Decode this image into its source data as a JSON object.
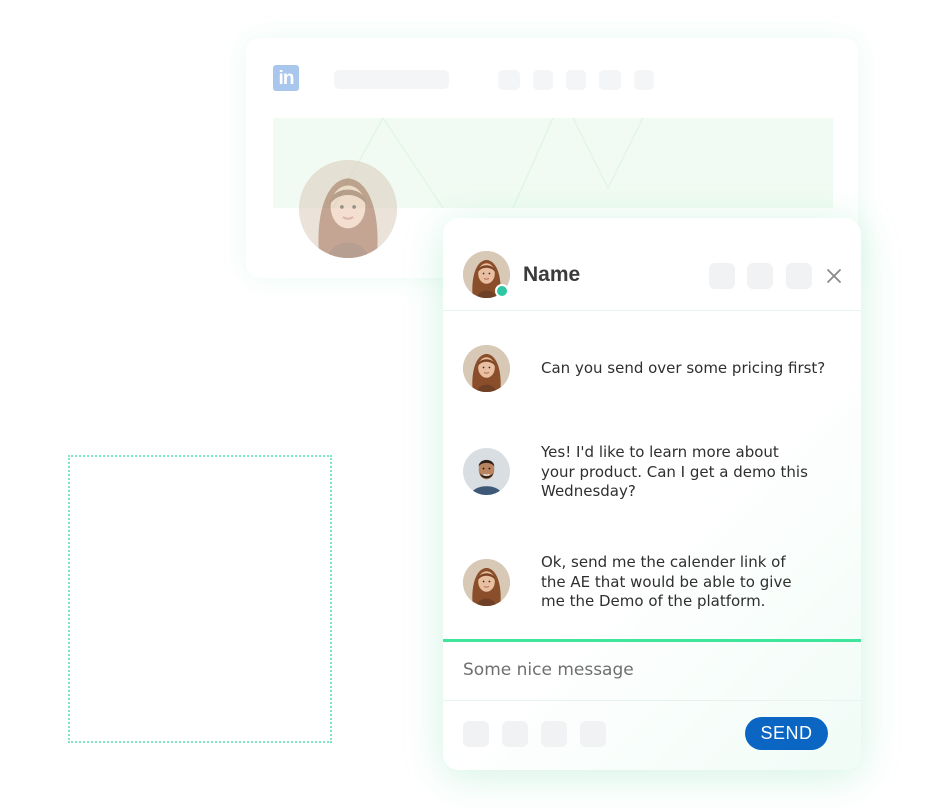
{
  "background_card": {
    "logo_icon": "linkedin-icon",
    "logo_text": "in",
    "brand_color": "#0a66c2"
  },
  "chat": {
    "contact_name": "Name",
    "status": "online",
    "close_icon": "close-icon",
    "messages": [
      {
        "sender": "contact",
        "text": "Can you send over some pricing first?"
      },
      {
        "sender": "user",
        "text": "Yes! I'd like to learn more about\nyour product. Can I get a demo this\nWednesday?"
      },
      {
        "sender": "contact",
        "text": "Ok, send me the calender link of\nthe AE that would be able to give\nme the Demo of the platform."
      }
    ],
    "compose_placeholder": "Some nice message",
    "send_label": "SEND"
  },
  "colors": {
    "accent_green": "#3fe59a",
    "online_status": "#2fc7a3",
    "send_button": "#0a66c2"
  }
}
